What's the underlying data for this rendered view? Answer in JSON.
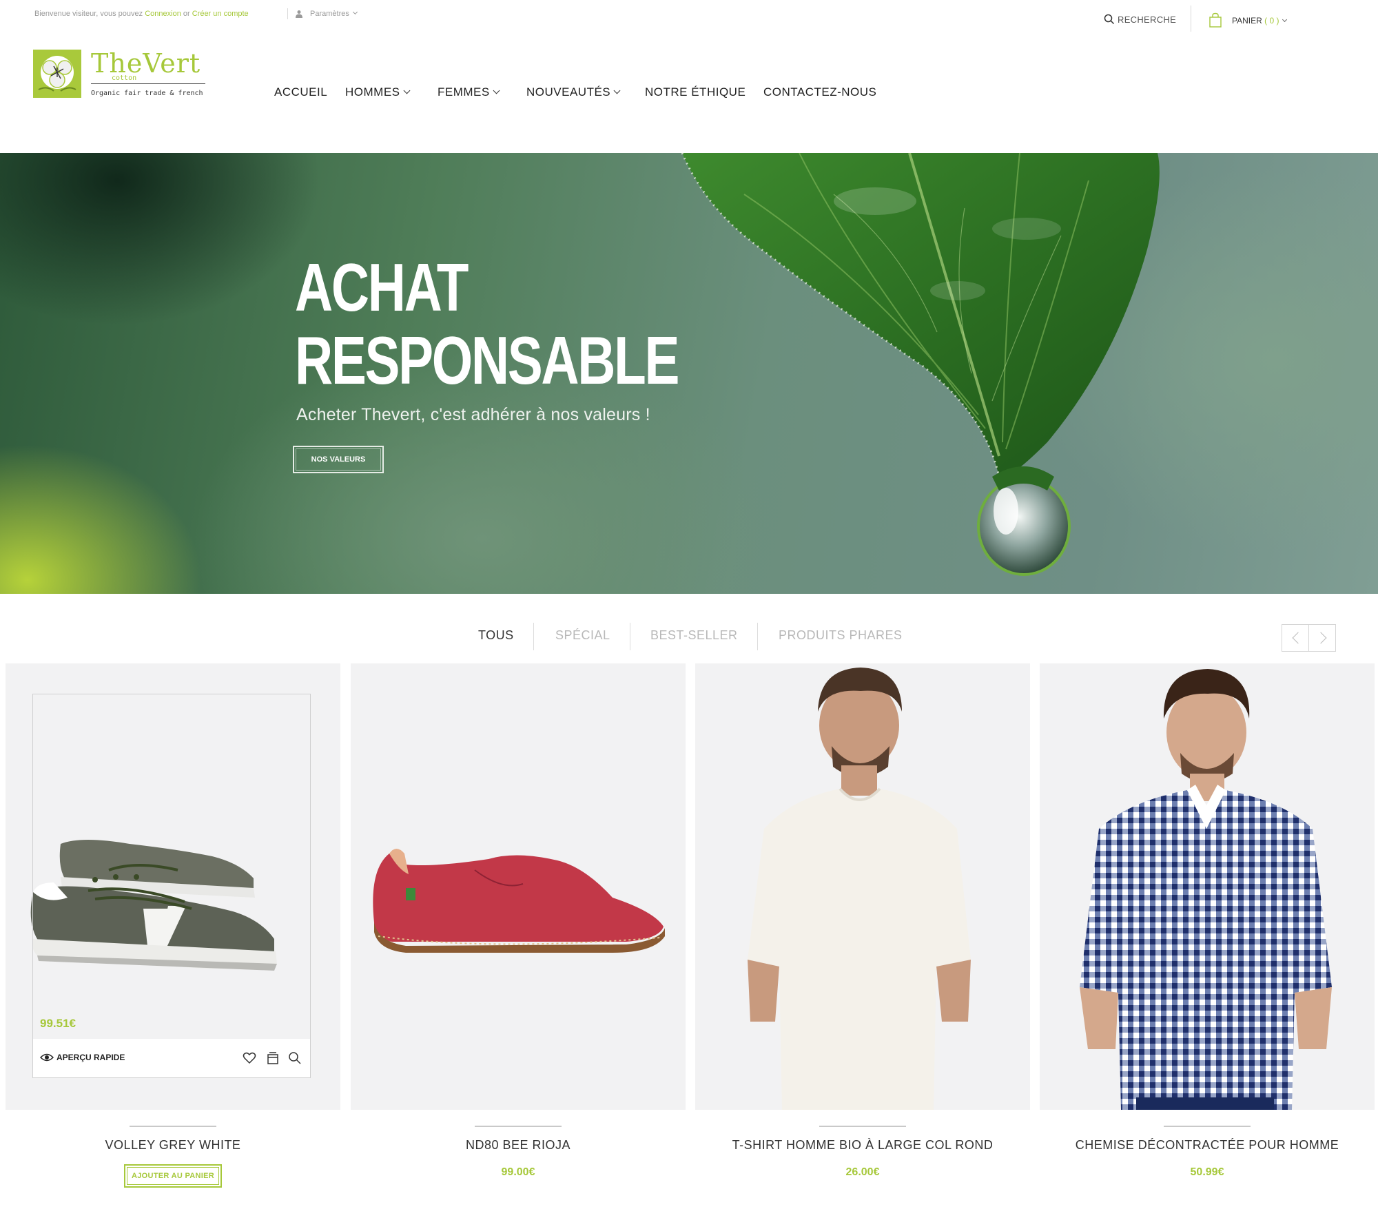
{
  "topbar": {
    "welcome_text": "Bienvenue visiteur, vous pouvez",
    "login_link": "Connexion",
    "or_text": "or",
    "register_link": "Créer un compte",
    "params_label": "Paramètres",
    "search_label": "RECHERCHE",
    "cart_label": "PANIER",
    "cart_count": "( 0 )"
  },
  "logo": {
    "name": "TheVert",
    "sub1": "cotton",
    "sub2": "Organic fair trade & french"
  },
  "nav": {
    "items": [
      {
        "label": "ACCUEIL"
      },
      {
        "label": "HOMMES"
      },
      {
        "label": "FEMMES"
      },
      {
        "label": "NOUVEAUTÉS"
      },
      {
        "label": "NOTRE ÉTHIQUE"
      },
      {
        "label": "CONTACTEZ-NOUS"
      }
    ]
  },
  "hero": {
    "title_line1": "ACHAT",
    "title_line2": "RESPONSABLE",
    "subtitle": "Acheter Thevert, c'est adhérer à nos valeurs !",
    "button": "NOS VALEURS"
  },
  "tabs": [
    {
      "label": "TOUS",
      "active": true
    },
    {
      "label": "SPÉCIAL",
      "active": false
    },
    {
      "label": "BEST-SELLER",
      "active": false
    },
    {
      "label": "PRODUITS PHARES",
      "active": false
    }
  ],
  "products": [
    {
      "name": "VOLLEY GREY WHITE",
      "price": "99.51€",
      "add_label": "AJOUTER AU PANIER",
      "quick_view": "APERÇU RAPIDE"
    },
    {
      "name": "ND80 BEE RIOJA",
      "price": "99.00€"
    },
    {
      "name": "T-SHIRT HOMME BIO À LARGE COL ROND",
      "price": "26.00€"
    },
    {
      "name": "CHEMISE DÉCONTRACTÉE POUR HOMME",
      "price": "50.99€"
    }
  ],
  "colors": {
    "accent": "#a6c83a",
    "text": "#333333",
    "muted": "#b8b8b8",
    "card_bg": "#f2f2f3"
  }
}
